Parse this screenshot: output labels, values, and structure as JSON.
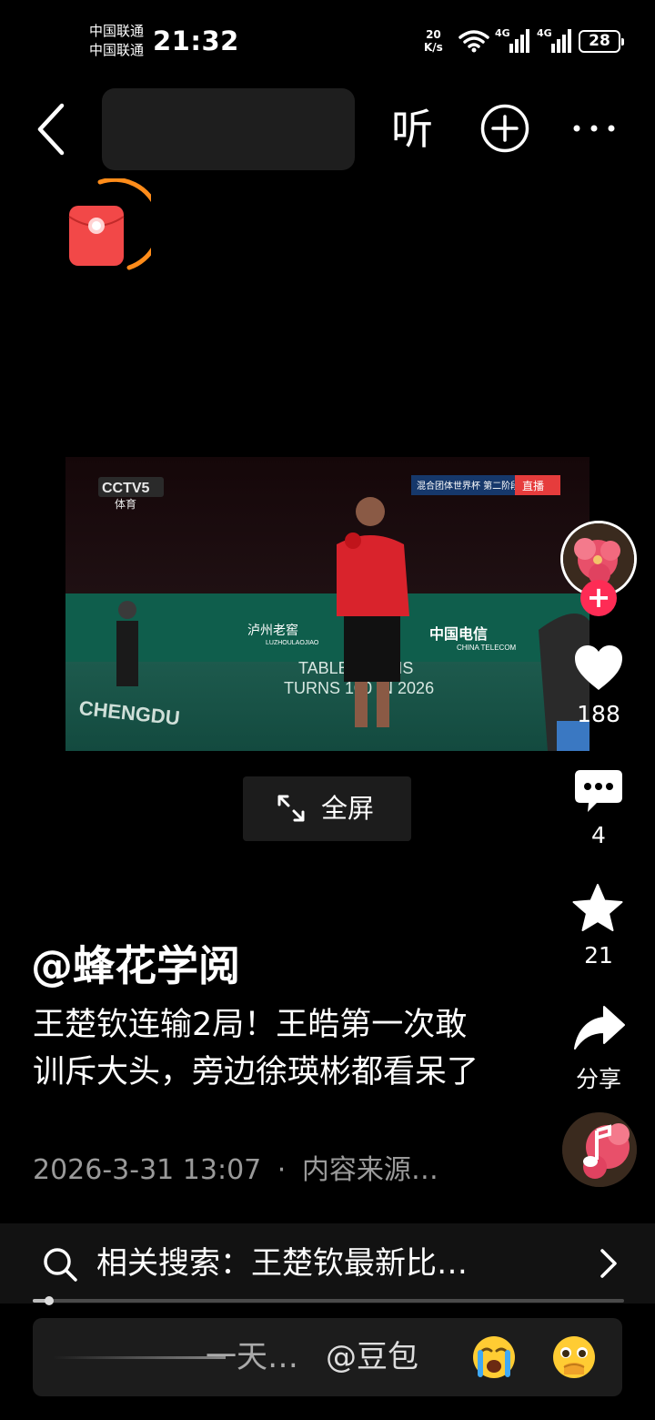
{
  "status": {
    "carriers": [
      "中国联通",
      "中国联通"
    ],
    "time": "21:32",
    "net_speed_value": "20",
    "net_speed_unit": "K/s",
    "sim_tags": [
      "4G",
      "4G"
    ],
    "battery": "28"
  },
  "topbar": {
    "listen_label": "听"
  },
  "video": {
    "broadcaster": "CCTV5",
    "channel_sub": "体育",
    "event_label": "混合团体世界杯 第二阶段",
    "live_label": "直播",
    "board_texts": [
      "TABLE TENNIS",
      "TURNS 100 IN 2026",
      "中国电信",
      "CHINA TELECOM",
      "泸州老窖",
      "LUZHOULAOJIAO",
      "CHENGDU"
    ]
  },
  "fullscreen": {
    "label": "全屏"
  },
  "actions": {
    "likes": "188",
    "comments": "4",
    "favorites": "21",
    "share_label": "分享"
  },
  "post": {
    "author": "@蜂花学阅",
    "description": "王楚钦连输2局！王皓第一次敢训斥大头，旁边徐瑛彬都看呆了",
    "datetime": "2026-3-31 13:07",
    "separator": "·",
    "source": "内容来源…"
  },
  "related_search": {
    "label": "相关搜索：",
    "query": "王楚钦最新比…"
  },
  "progress": {
    "fraction": 0.027
  },
  "comment_bar": {
    "placeholder": "一天…",
    "mention": "@豆包",
    "emojis": [
      "crying-face-emoji",
      "pleading-face-emoji"
    ]
  },
  "colors": {
    "follow_badge": "#fe2c55",
    "red_packet": "#f24848",
    "red_packet_ring": "#ff8c1a"
  }
}
